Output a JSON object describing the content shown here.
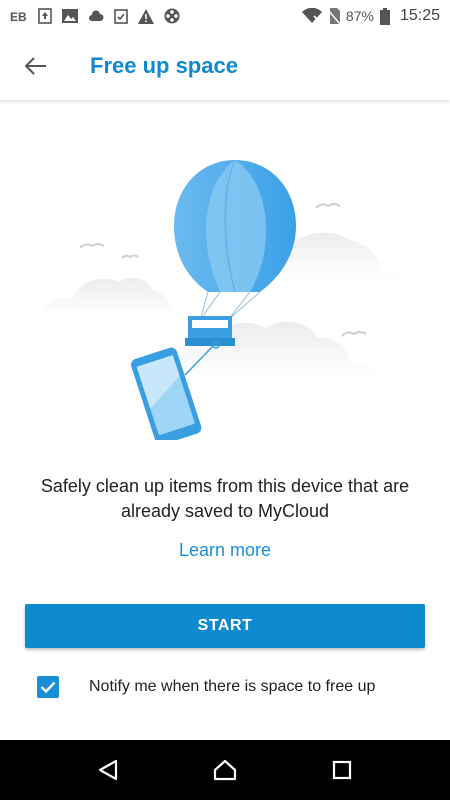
{
  "status_bar": {
    "battery_percent": "87%",
    "time": "15:25",
    "icons": [
      "app-icon",
      "upload-icon",
      "image-icon",
      "cloud-icon",
      "clipboard-check-icon",
      "warning-icon",
      "film-reel-icon"
    ]
  },
  "app_bar": {
    "title": "Free up space",
    "back_icon": "arrow-left-icon"
  },
  "main": {
    "description": "Safely clean up items from this device that are already saved to MyCloud",
    "learn_more": "Learn more",
    "start_label": "START",
    "notify_label": "Notify me when there is space to free up",
    "notify_checked": true
  },
  "nav_bar": {
    "buttons": [
      "back-icon",
      "home-icon",
      "recents-icon"
    ]
  },
  "colors": {
    "accent": "#0f89cf",
    "link": "#1b8fd6",
    "text": "#222222"
  }
}
